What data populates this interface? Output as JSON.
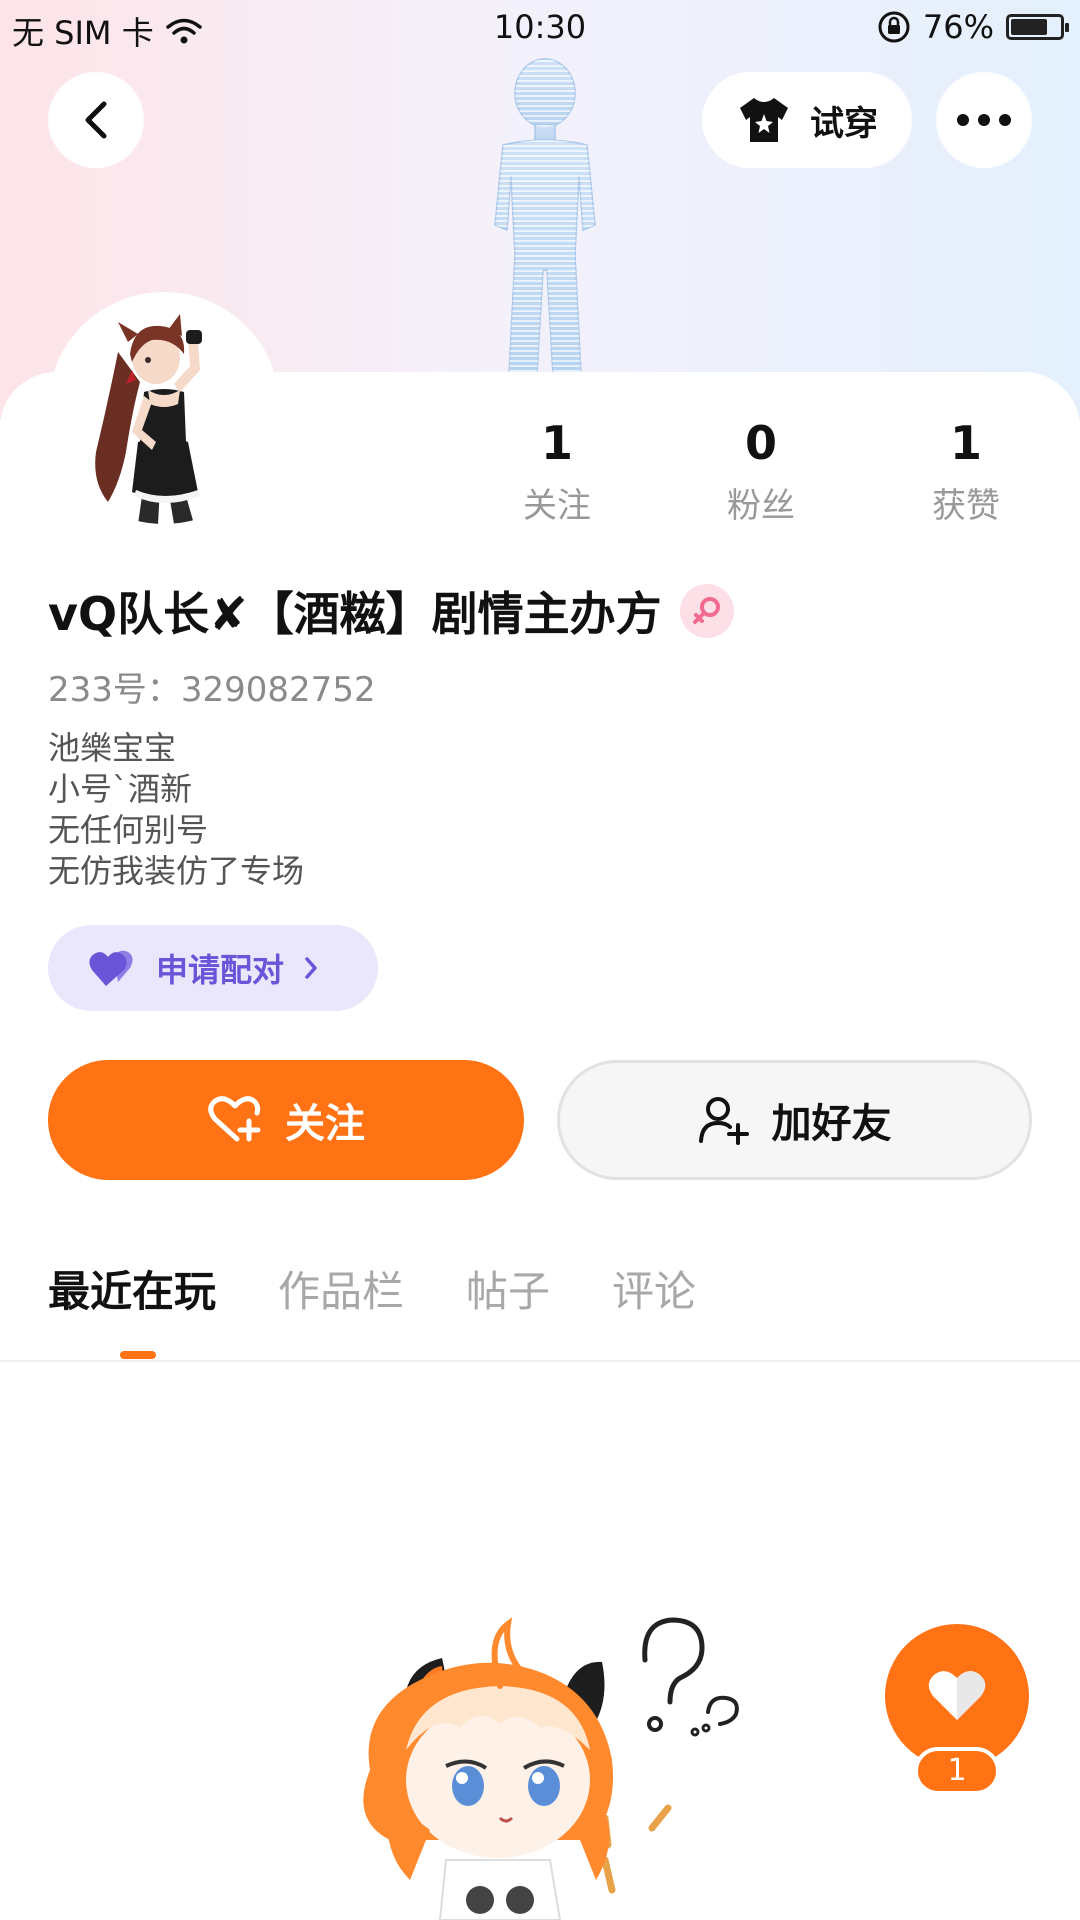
{
  "status_bar": {
    "carrier": "无 SIM 卡",
    "time": "10:30",
    "battery": "76%",
    "battery_level": 0.76
  },
  "top_bar": {
    "tryon_label": "试穿"
  },
  "profile": {
    "stats": [
      {
        "value": "1",
        "label": "关注"
      },
      {
        "value": "0",
        "label": "粉丝"
      },
      {
        "value": "1",
        "label": "获赞"
      }
    ],
    "name": "vQ队长✘【酒糍】剧情主办方",
    "uid": "233号：329082752",
    "bio": [
      "池樂宝宝",
      "小号`酒新",
      "无任何别号",
      "无仿我装仿了专场"
    ],
    "pair_label": "申请配对"
  },
  "actions": {
    "follow_label": "关注",
    "friend_label": "加好友"
  },
  "tabs": [
    {
      "label": "最近在玩",
      "active": true
    },
    {
      "label": "作品栏",
      "active": false
    },
    {
      "label": "帖子",
      "active": false
    },
    {
      "label": "评论",
      "active": false
    }
  ],
  "like": {
    "count": "1"
  },
  "colors": {
    "accent": "#ff7315",
    "pair_purple": "#6a55d8",
    "pair_bg": "#eae6fb",
    "gender_pink": "#f06b8f"
  }
}
